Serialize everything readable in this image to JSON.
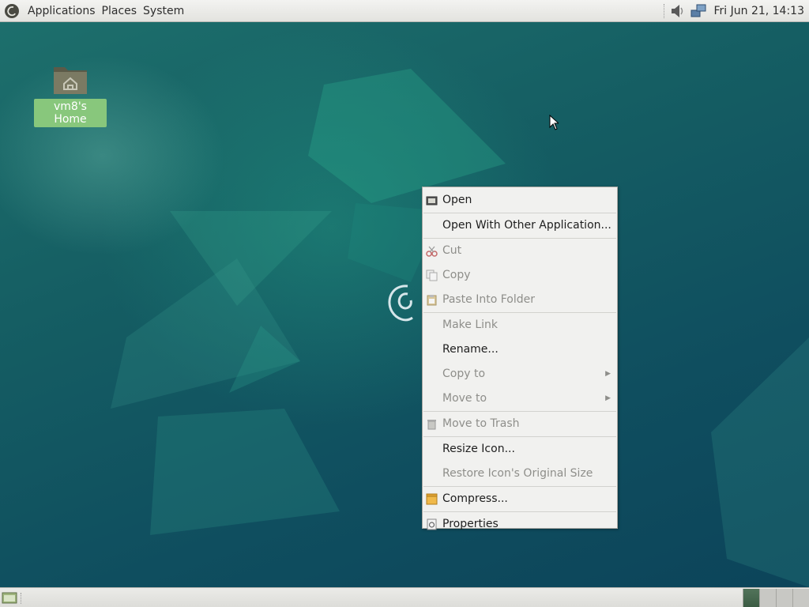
{
  "top_panel": {
    "menus": [
      "Applications",
      "Places",
      "System"
    ],
    "clock": "Fri Jun 21, 14:13",
    "tray_icons": [
      "volume-icon",
      "network-icon"
    ]
  },
  "desktop": {
    "home_icon_label": "vm8's Home",
    "background_colors": [
      "#1d6f6c",
      "#0c445a"
    ]
  },
  "context_menu": {
    "items": [
      {
        "label": "Open",
        "icon": "open-icon",
        "enabled": true
      },
      {
        "label": "Open With Other Application...",
        "enabled": true
      },
      {
        "label": "Cut",
        "icon": "cut-icon",
        "enabled": false
      },
      {
        "label": "Copy",
        "icon": "copy-icon",
        "enabled": false
      },
      {
        "label": "Paste Into Folder",
        "icon": "paste-icon",
        "enabled": false
      },
      {
        "label": "Make Link",
        "enabled": false
      },
      {
        "label": "Rename...",
        "enabled": true
      },
      {
        "label": "Copy to",
        "enabled": false,
        "submenu": true
      },
      {
        "label": "Move to",
        "enabled": false,
        "submenu": true
      },
      {
        "label": "Move to Trash",
        "icon": "trash-icon",
        "enabled": false
      },
      {
        "label": "Resize Icon...",
        "enabled": true
      },
      {
        "label": "Restore Icon's Original Size",
        "enabled": false
      },
      {
        "label": "Compress...",
        "icon": "archive-icon",
        "enabled": true
      },
      {
        "label": "Properties",
        "icon": "properties-icon",
        "enabled": true
      }
    ]
  },
  "bottom_panel": {
    "workspaces": 4,
    "active_workspace": 1
  }
}
